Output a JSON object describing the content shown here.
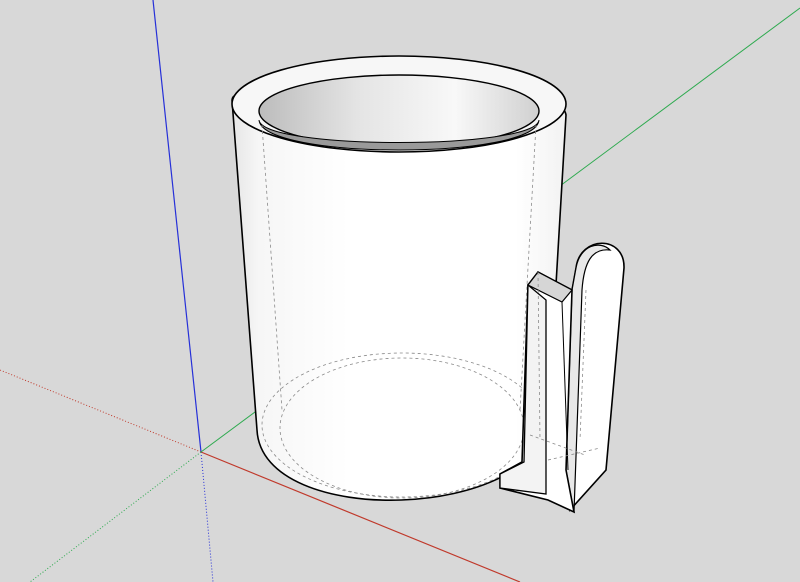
{
  "scene": {
    "background_color": "#d8d8d8",
    "axis_colors": {
      "red": "#c0392b",
      "green": "#27ae60",
      "blue": "#1e2ad6"
    },
    "model": {
      "name": "mug",
      "body_fill": "#ffffff",
      "edge_color": "#000000",
      "hidden_edge_color": "#8a8a8a"
    }
  }
}
